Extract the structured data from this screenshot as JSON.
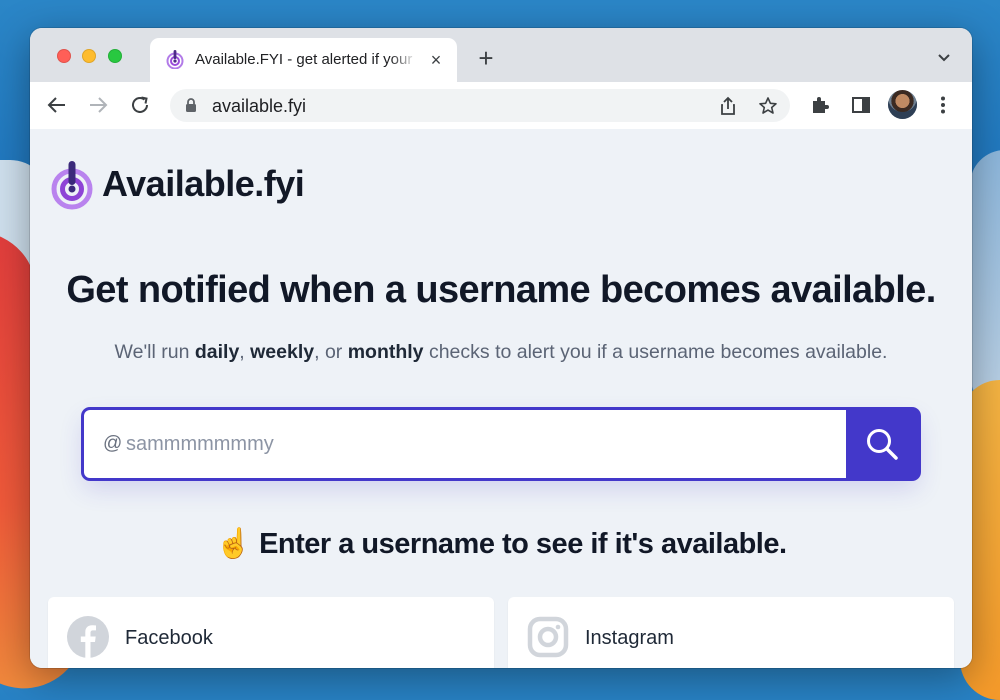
{
  "browser": {
    "tab": {
      "title": "Available.FYI - get alerted if your desired username becomes available",
      "close": "×"
    },
    "new_tab": "+",
    "address": {
      "url": "available.fyi"
    }
  },
  "site": {
    "logo": "Available.fyi",
    "headline": "Get notified when a username becomes available.",
    "subline": {
      "intro": "We'll run ",
      "freq1": "daily",
      "sep1": ", ",
      "freq2": "weekly",
      "sep2": ", or ",
      "freq3": "monthly",
      "outro": " checks to alert you if a username becomes available."
    },
    "search": {
      "prefix": "@",
      "placeholder": "sammmmmmmy",
      "value": ""
    },
    "prompt": {
      "emoji": "☝️",
      "text": "Enter a username to see if it's available."
    },
    "platforms": [
      {
        "label": "Facebook"
      },
      {
        "label": "Instagram"
      }
    ]
  },
  "colors": {
    "accent": "#4338ca",
    "logo_purple": "#9b4ddb",
    "page_bg": "#eef2f7"
  }
}
